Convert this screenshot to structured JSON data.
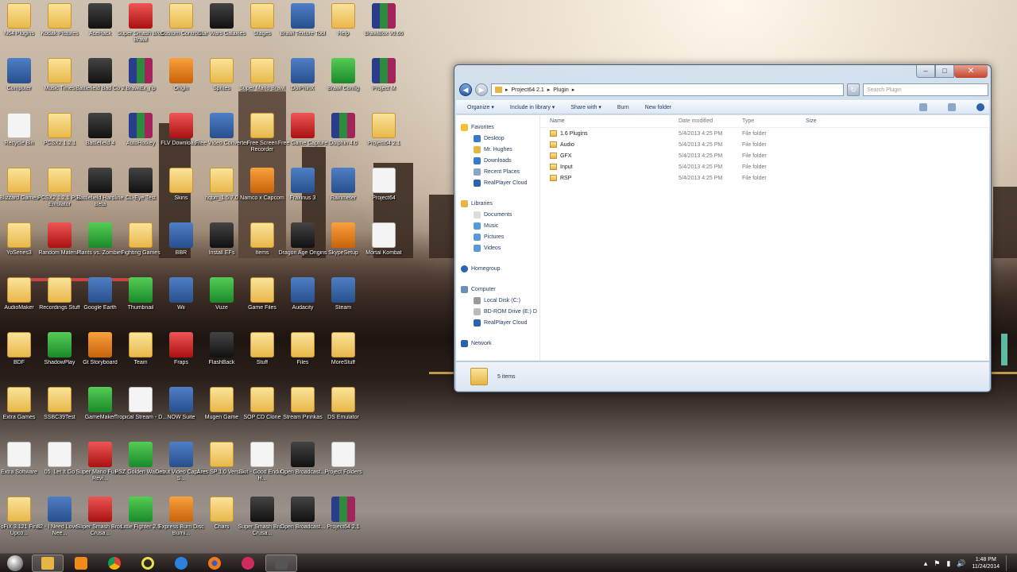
{
  "desktop": {
    "icons": [
      {
        "label": "N64 Plugins",
        "kind": "folder",
        "col": 0,
        "row": 0
      },
      {
        "label": "Kodak Pictures",
        "kind": "folder",
        "col": 1,
        "row": 0
      },
      {
        "label": "AceHack",
        "kind": "dark",
        "col": 2,
        "row": 0
      },
      {
        "label": "Super Smash Bros Brawl",
        "kind": "red",
        "col": 3,
        "row": 0
      },
      {
        "label": "Custom Controls",
        "kind": "folder",
        "col": 4,
        "row": 0
      },
      {
        "label": "Star Wars Galaxies",
        "kind": "dark",
        "col": 5,
        "row": 0
      },
      {
        "label": "Stages",
        "kind": "folder",
        "col": 6,
        "row": 0
      },
      {
        "label": "Brawl Texture Tool",
        "kind": "app",
        "col": 7,
        "row": 0
      },
      {
        "label": "Help",
        "kind": "folder",
        "col": 8,
        "row": 0
      },
      {
        "label": "BrawlBox v0.66",
        "kind": "rar",
        "col": 9,
        "row": 0
      },
      {
        "label": "Computer",
        "kind": "app",
        "col": 0,
        "row": 1
      },
      {
        "label": "Music Times",
        "kind": "folder",
        "col": 1,
        "row": 1
      },
      {
        "label": "Battlefield Bad Co 2",
        "kind": "dark",
        "col": 2,
        "row": 1
      },
      {
        "label": "BrawlEx_rip",
        "kind": "rar",
        "col": 3,
        "row": 1
      },
      {
        "label": "Origin",
        "kind": "orange",
        "col": 4,
        "row": 1
      },
      {
        "label": "Sprites",
        "kind": "folder",
        "col": 5,
        "row": 1
      },
      {
        "label": "Super Mario Brawl",
        "kind": "folder",
        "col": 6,
        "row": 1
      },
      {
        "label": "DolPhinX",
        "kind": "app",
        "col": 7,
        "row": 1
      },
      {
        "label": "Brawl Config",
        "kind": "green",
        "col": 8,
        "row": 1
      },
      {
        "label": "Project M",
        "kind": "rar",
        "col": 9,
        "row": 1
      },
      {
        "label": "Recycle Bin",
        "kind": "file",
        "col": 0,
        "row": 2
      },
      {
        "label": "PCSX2 1.2.1",
        "kind": "folder",
        "col": 1,
        "row": 2
      },
      {
        "label": "Battlefield 4",
        "kind": "dark",
        "col": 2,
        "row": 2
      },
      {
        "label": "AutoHotkey",
        "kind": "rar",
        "col": 3,
        "row": 2
      },
      {
        "label": "FLV Downloader",
        "kind": "red",
        "col": 4,
        "row": 2
      },
      {
        "label": "Free Video Converter",
        "kind": "app",
        "col": 5,
        "row": 2
      },
      {
        "label": "Free Screen Recorder",
        "kind": "folder",
        "col": 6,
        "row": 2
      },
      {
        "label": "Free Game Capture",
        "kind": "red",
        "col": 7,
        "row": 2
      },
      {
        "label": "Dolphin 4.0",
        "kind": "rar",
        "col": 8,
        "row": 2
      },
      {
        "label": "Project64 2.1",
        "kind": "folder",
        "col": 9,
        "row": 2
      },
      {
        "label": "Blizzard Games",
        "kind": "folder",
        "col": 0,
        "row": 3
      },
      {
        "label": "PCSX2 1.2.1 PS2 Emulator",
        "kind": "folder",
        "col": 1,
        "row": 3
      },
      {
        "label": "Battlefield Hardline Beta",
        "kind": "dark",
        "col": 2,
        "row": 3
      },
      {
        "label": "CL-Eye Test",
        "kind": "dark",
        "col": 3,
        "row": 3
      },
      {
        "label": "Skins",
        "kind": "folder",
        "col": 4,
        "row": 3
      },
      {
        "label": "hqbrr_1.5.7.0",
        "kind": "folder",
        "col": 5,
        "row": 3
      },
      {
        "label": "Namco x Capcom",
        "kind": "orange",
        "col": 6,
        "row": 3
      },
      {
        "label": "Fraxinus 3",
        "kind": "app",
        "col": 7,
        "row": 3
      },
      {
        "label": "Rainmeter",
        "kind": "app",
        "col": 8,
        "row": 3
      },
      {
        "label": "Project64",
        "kind": "file",
        "col": 9,
        "row": 3
      },
      {
        "label": "YoSeries3",
        "kind": "folder",
        "col": 0,
        "row": 4
      },
      {
        "label": "Random Material",
        "kind": "red",
        "col": 1,
        "row": 4
      },
      {
        "label": "Plants vs. Zombies",
        "kind": "green",
        "col": 2,
        "row": 4
      },
      {
        "label": "Fighting Games",
        "kind": "folder",
        "col": 3,
        "row": 4
      },
      {
        "label": "BBR",
        "kind": "app",
        "col": 4,
        "row": 4
      },
      {
        "label": "Install EFs",
        "kind": "dark",
        "col": 5,
        "row": 4
      },
      {
        "label": "Items",
        "kind": "folder",
        "col": 6,
        "row": 4
      },
      {
        "label": "Dragon Age Origins",
        "kind": "dark",
        "col": 7,
        "row": 4
      },
      {
        "label": "SkypeSetup",
        "kind": "orange",
        "col": 8,
        "row": 4
      },
      {
        "label": "Mortal Kombat",
        "kind": "file",
        "col": 9,
        "row": 4
      },
      {
        "label": "AudioMaker",
        "kind": "folder",
        "col": 0,
        "row": 5
      },
      {
        "label": "Recordings Stuff",
        "kind": "folder",
        "col": 1,
        "row": 5
      },
      {
        "label": "Google Earth",
        "kind": "app",
        "col": 2,
        "row": 5
      },
      {
        "label": "Thumbnail",
        "kind": "green",
        "col": 3,
        "row": 5
      },
      {
        "label": "Wii",
        "kind": "app",
        "col": 4,
        "row": 5
      },
      {
        "label": "Vuze",
        "kind": "green",
        "col": 5,
        "row": 5
      },
      {
        "label": "Game Files",
        "kind": "folder",
        "col": 6,
        "row": 5
      },
      {
        "label": "Audacity",
        "kind": "app",
        "col": 7,
        "row": 5
      },
      {
        "label": "Steam",
        "kind": "app",
        "col": 8,
        "row": 5
      },
      {
        "label": "BDF",
        "kind": "folder",
        "col": 0,
        "row": 6
      },
      {
        "label": "ShadowPlay",
        "kind": "green",
        "col": 1,
        "row": 6
      },
      {
        "label": "Gt Storyboard",
        "kind": "orange",
        "col": 2,
        "row": 6
      },
      {
        "label": "Team",
        "kind": "folder",
        "col": 3,
        "row": 6
      },
      {
        "label": "Fraps",
        "kind": "red",
        "col": 4,
        "row": 6
      },
      {
        "label": "FlashBack",
        "kind": "dark",
        "col": 5,
        "row": 6
      },
      {
        "label": "Stuff",
        "kind": "folder",
        "col": 6,
        "row": 6
      },
      {
        "label": "Files",
        "kind": "folder",
        "col": 7,
        "row": 6
      },
      {
        "label": "MoreStuff",
        "kind": "folder",
        "col": 8,
        "row": 6
      },
      {
        "label": "Extra Games",
        "kind": "folder",
        "col": 0,
        "row": 7
      },
      {
        "label": "SSBC39Test",
        "kind": "folder",
        "col": 1,
        "row": 7
      },
      {
        "label": "GameMaker",
        "kind": "green",
        "col": 2,
        "row": 7
      },
      {
        "label": "Tropical Stream - D...",
        "kind": "file",
        "col": 3,
        "row": 7
      },
      {
        "label": "NOW Suite",
        "kind": "app",
        "col": 4,
        "row": 7
      },
      {
        "label": "Mugen Game",
        "kind": "folder",
        "col": 5,
        "row": 7
      },
      {
        "label": "SOP CD Clone",
        "kind": "folder",
        "col": 6,
        "row": 7
      },
      {
        "label": "Stream Pinnkas",
        "kind": "folder",
        "col": 7,
        "row": 7
      },
      {
        "label": "DS Emulator",
        "kind": "folder",
        "col": 8,
        "row": 7
      },
      {
        "label": "Extra Software",
        "kind": "file",
        "col": 0,
        "row": 8
      },
      {
        "label": "05. Let It Go",
        "kind": "file",
        "col": 1,
        "row": 8
      },
      {
        "label": "Super Mario Fusion Revi...",
        "kind": "red",
        "col": 2,
        "row": 8
      },
      {
        "label": "PSZ Golden Warfare",
        "kind": "green",
        "col": 3,
        "row": 8
      },
      {
        "label": "Debut Video Capture S...",
        "kind": "app",
        "col": 4,
        "row": 8
      },
      {
        "label": "Ares SP 1.0 Version",
        "kind": "folder",
        "col": 5,
        "row": 8
      },
      {
        "label": "Skit - Good Ending H...",
        "kind": "file",
        "col": 6,
        "row": 8
      },
      {
        "label": "Open Broadcast...",
        "kind": "dark",
        "col": 7,
        "row": 8
      },
      {
        "label": "Project Folders",
        "kind": "file",
        "col": 8,
        "row": 8
      },
      {
        "label": "FoFiX 3.121 Final Upco...",
        "kind": "folder",
        "col": 0,
        "row": 9
      },
      {
        "label": "82 - I Need Love II Nee...",
        "kind": "app",
        "col": 1,
        "row": 9
      },
      {
        "label": "Super Smash Bros. Crusa...",
        "kind": "red",
        "col": 2,
        "row": 9
      },
      {
        "label": "Little Fighter 2.5",
        "kind": "green",
        "col": 3,
        "row": 9
      },
      {
        "label": "Express Burn Disc Burni...",
        "kind": "orange",
        "col": 4,
        "row": 9
      },
      {
        "label": "Chars",
        "kind": "folder",
        "col": 5,
        "row": 9
      },
      {
        "label": "Super Smash Bros. Crusa...",
        "kind": "dark",
        "col": 6,
        "row": 9
      },
      {
        "label": "Open Broadcast...",
        "kind": "dark",
        "col": 7,
        "row": 9
      },
      {
        "label": "Project64 2.1",
        "kind": "rar",
        "col": 8,
        "row": 9
      }
    ]
  },
  "explorer": {
    "breadcrumb": [
      "Project64 2.1",
      "Plugin"
    ],
    "search_placeholder": "Search Plugin",
    "commands": {
      "organize": "Organize ▾",
      "include": "Include in library ▾",
      "share": "Share with ▾",
      "burn": "Burn",
      "new_folder": "New folder"
    },
    "nav": {
      "favorites": "Favorites",
      "desktop": "Desktop",
      "mr_hughes": "Mr. Hughes",
      "downloads": "Downloads",
      "recent": "Recent Places",
      "realplayer1": "RealPlayer Cloud",
      "libraries": "Libraries",
      "documents": "Documents",
      "music": "Music",
      "pictures": "Pictures",
      "videos": "Videos",
      "homegroup": "Homegroup",
      "computer": "Computer",
      "local_disk": "Local Disk (C:)",
      "bdrom": "BD-ROM Drive (E:) D",
      "realplayer2": "RealPlayer Cloud",
      "network": "Network"
    },
    "columns": {
      "name": "Name",
      "date": "Date modified",
      "type": "Type",
      "size": "Size"
    },
    "files": [
      {
        "name": "1.6 Plugins",
        "date": "5/4/2013 4:25 PM",
        "type": "File folder",
        "size": ""
      },
      {
        "name": "Audio",
        "date": "5/4/2013 4:25 PM",
        "type": "File folder",
        "size": ""
      },
      {
        "name": "GFX",
        "date": "5/4/2013 4:25 PM",
        "type": "File folder",
        "size": ""
      },
      {
        "name": "Input",
        "date": "5/4/2013 4:25 PM",
        "type": "File folder",
        "size": ""
      },
      {
        "name": "RSP",
        "date": "5/4/2013 4:25 PM",
        "type": "File folder",
        "size": ""
      }
    ],
    "status": "5 items"
  },
  "taskbar": {
    "time": "1:48 PM",
    "date": "11/24/2014"
  }
}
